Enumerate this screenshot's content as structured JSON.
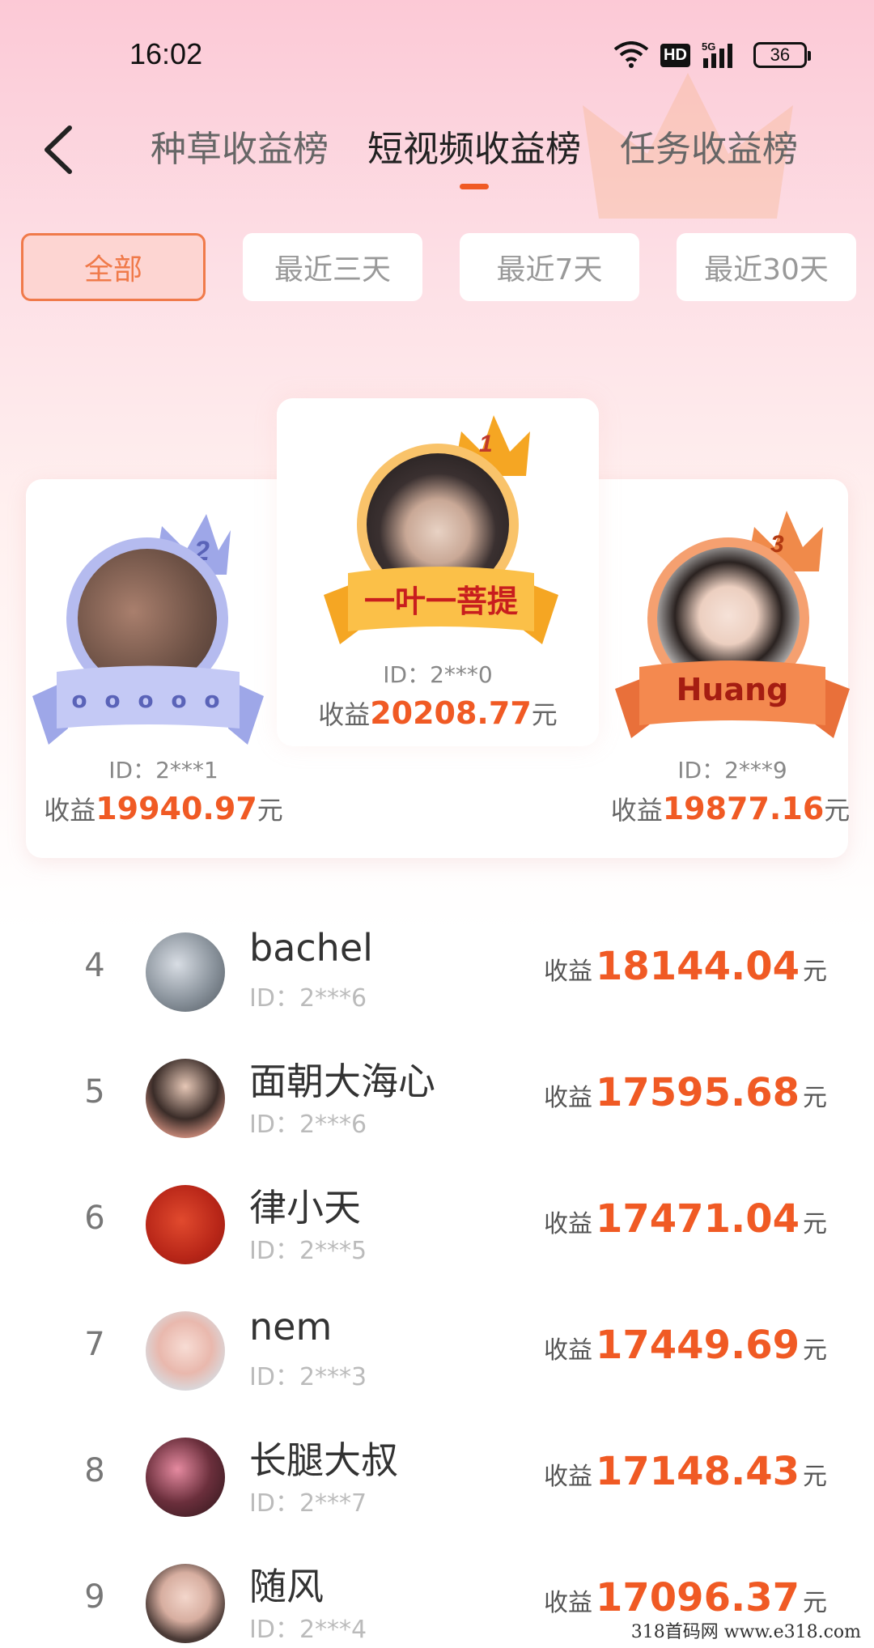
{
  "status_bar": {
    "time": "16:02",
    "hd_label": "HD",
    "network_label": "5G",
    "battery": "36"
  },
  "header": {
    "tabs": [
      {
        "label": "种草收益榜",
        "active": false
      },
      {
        "label": "短视频收益榜",
        "active": true
      },
      {
        "label": "任务收益榜",
        "active": false
      }
    ]
  },
  "filters": [
    {
      "label": "全部",
      "active": true
    },
    {
      "label": "最近三天",
      "active": false
    },
    {
      "label": "最近7天",
      "active": false
    },
    {
      "label": "最近30天",
      "active": false
    }
  ],
  "podium": {
    "first": {
      "rank": "1",
      "name": "一叶一菩提",
      "id_label": "ID：",
      "id": "2***0",
      "income_label": "收益",
      "income": "20208.77",
      "unit": "元"
    },
    "second": {
      "rank": "2",
      "name": "o o o o o",
      "id_label": "ID：",
      "id": "2***1",
      "income_label": "收益",
      "income": "19940.97",
      "unit": "元"
    },
    "third": {
      "rank": "3",
      "name": "Huang",
      "id_label": "ID：",
      "id": "2***9",
      "income_label": "收益",
      "income": "19877.16",
      "unit": "元"
    }
  },
  "list": [
    {
      "rank": "4",
      "name": "bachel",
      "id_label": "ID：",
      "id": "2***6",
      "income_label": "收益",
      "income": "18144.04",
      "unit": "元"
    },
    {
      "rank": "5",
      "name": "面朝大海心",
      "id_label": "ID：",
      "id": "2***6",
      "income_label": "收益",
      "income": "17595.68",
      "unit": "元"
    },
    {
      "rank": "6",
      "name": "律小天",
      "id_label": "ID：",
      "id": "2***5",
      "income_label": "收益",
      "income": "17471.04",
      "unit": "元"
    },
    {
      "rank": "7",
      "name": "nem",
      "id_label": "ID：",
      "id": "2***3",
      "income_label": "收益",
      "income": "17449.69",
      "unit": "元"
    },
    {
      "rank": "8",
      "name": "长腿大叔",
      "id_label": "ID：",
      "id": "2***7",
      "income_label": "收益",
      "income": "17148.43",
      "unit": "元"
    },
    {
      "rank": "9",
      "name": "随风",
      "id_label": "ID：",
      "id": "2***4",
      "income_label": "收益",
      "income": "17096.37",
      "unit": "元"
    }
  ],
  "watermark": "318首码网  www.e318.com",
  "colors": {
    "accent": "#f05a24",
    "gold": "#f5a623",
    "silver": "#9ea7e8",
    "bronze": "#f08a4a"
  }
}
